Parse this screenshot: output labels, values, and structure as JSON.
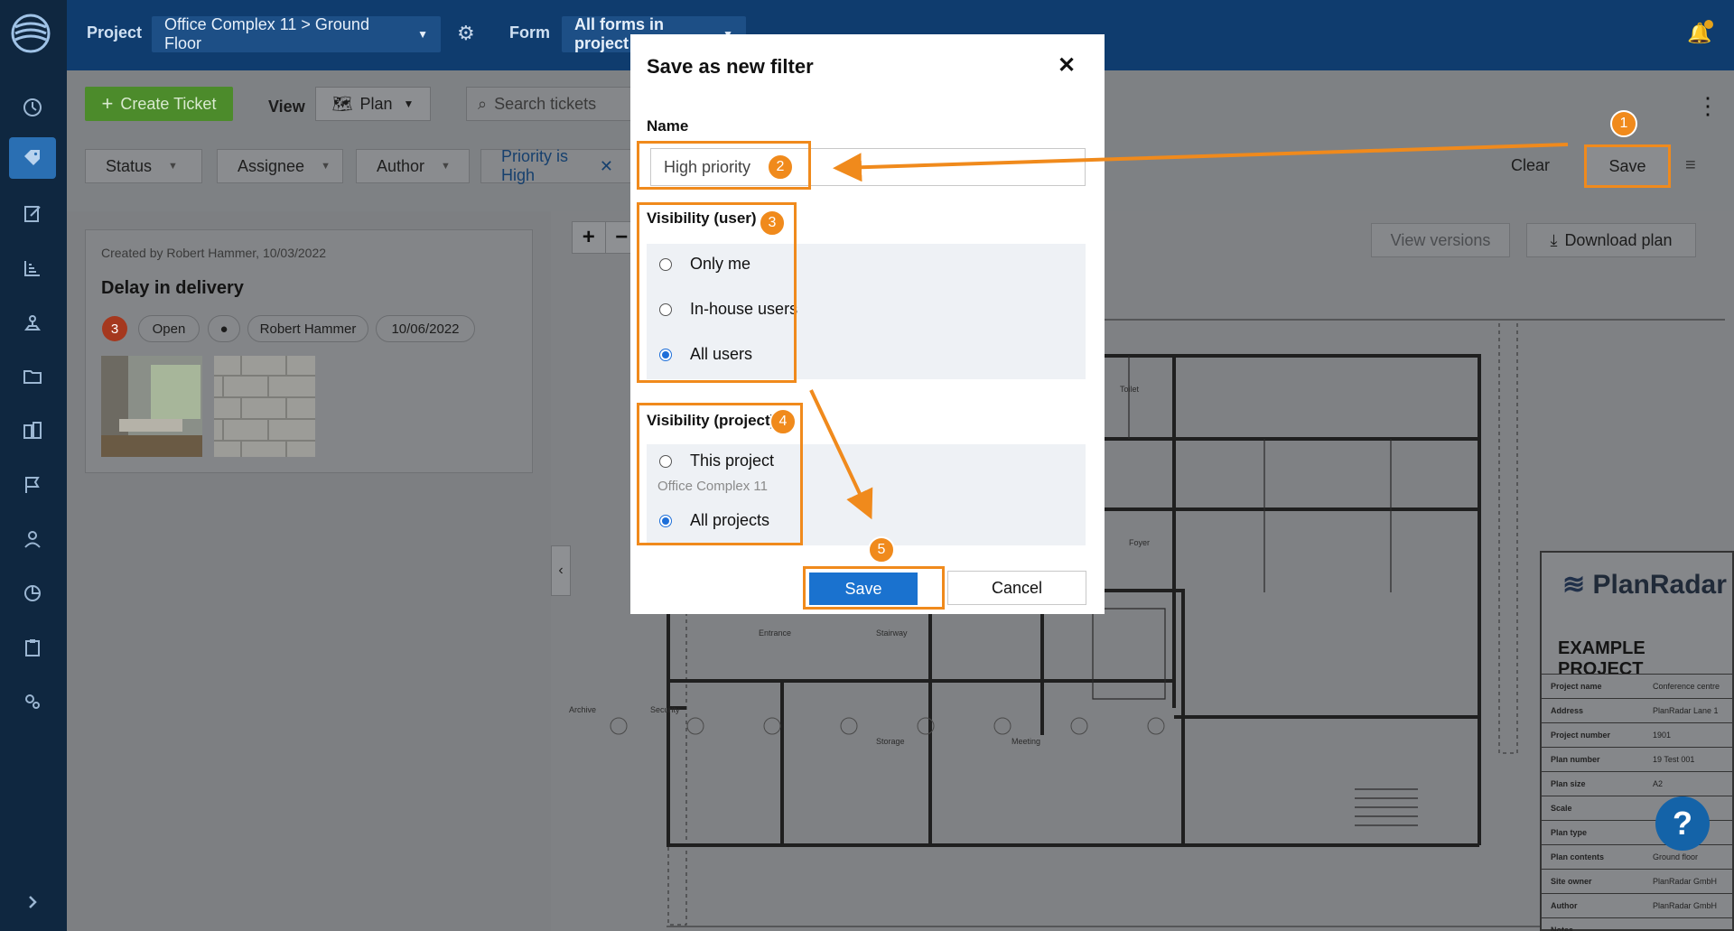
{
  "topbar": {
    "project_label": "Project",
    "project_value": "Office Complex 11 > Ground Floor",
    "form_label": "Form",
    "form_value": "All forms in project"
  },
  "toolbar": {
    "create_ticket": "Create Ticket",
    "view_label": "View",
    "view_value": "Plan",
    "search_placeholder": "Search tickets",
    "filters": [
      "Status",
      "Assignee",
      "Author"
    ],
    "priority_filter": "Priority is High",
    "clear": "Clear",
    "save": "Save"
  },
  "ticket": {
    "created": "Created by Robert Hammer, 10/03/2022",
    "title": "Delay in delivery",
    "count": "3",
    "status": "Open",
    "assignee": "Robert Hammer",
    "date": "10/06/2022"
  },
  "plan": {
    "view_versions": "View versions",
    "download_plan": "Download plan",
    "help": "?",
    "title_block": {
      "logo": "PlanRadar",
      "example": "EXAMPLE PROJECT",
      "rows": [
        {
          "k": "Project name",
          "v": "Conference centre"
        },
        {
          "k": "Address",
          "v": "PlanRadar Lane 1"
        },
        {
          "k": "Project number",
          "v": "1901"
        },
        {
          "k": "Plan number",
          "v": "19 Test 001"
        },
        {
          "k": "Plan size",
          "v": "A2"
        },
        {
          "k": "Scale",
          "v": ""
        },
        {
          "k": "Plan type",
          "v": ""
        },
        {
          "k": "Plan contents",
          "v": "Ground floor"
        },
        {
          "k": "Site owner",
          "v": "PlanRadar GmbH"
        },
        {
          "k": "Author",
          "v": "PlanRadar GmbH"
        },
        {
          "k": "Notes",
          "v": ""
        }
      ]
    }
  },
  "modal": {
    "title": "Save as new filter",
    "name_label": "Name",
    "name_value": "High priority",
    "visibility_user_label": "Visibility (user)",
    "user_options": [
      "Only me",
      "In-house users",
      "All users"
    ],
    "user_selected": "All users",
    "visibility_project_label": "Visibility (project)",
    "project_options": [
      "This project",
      "All projects"
    ],
    "project_sub": "Office Complex 11",
    "project_selected": "All projects",
    "save": "Save",
    "cancel": "Cancel"
  },
  "steps": [
    "1",
    "2",
    "3",
    "4",
    "5"
  ],
  "colors": {
    "accent": "#f08a1c",
    "primary": "#1a72cf",
    "sidebar": "#0f2740",
    "topbar": "#0f3c6e"
  }
}
